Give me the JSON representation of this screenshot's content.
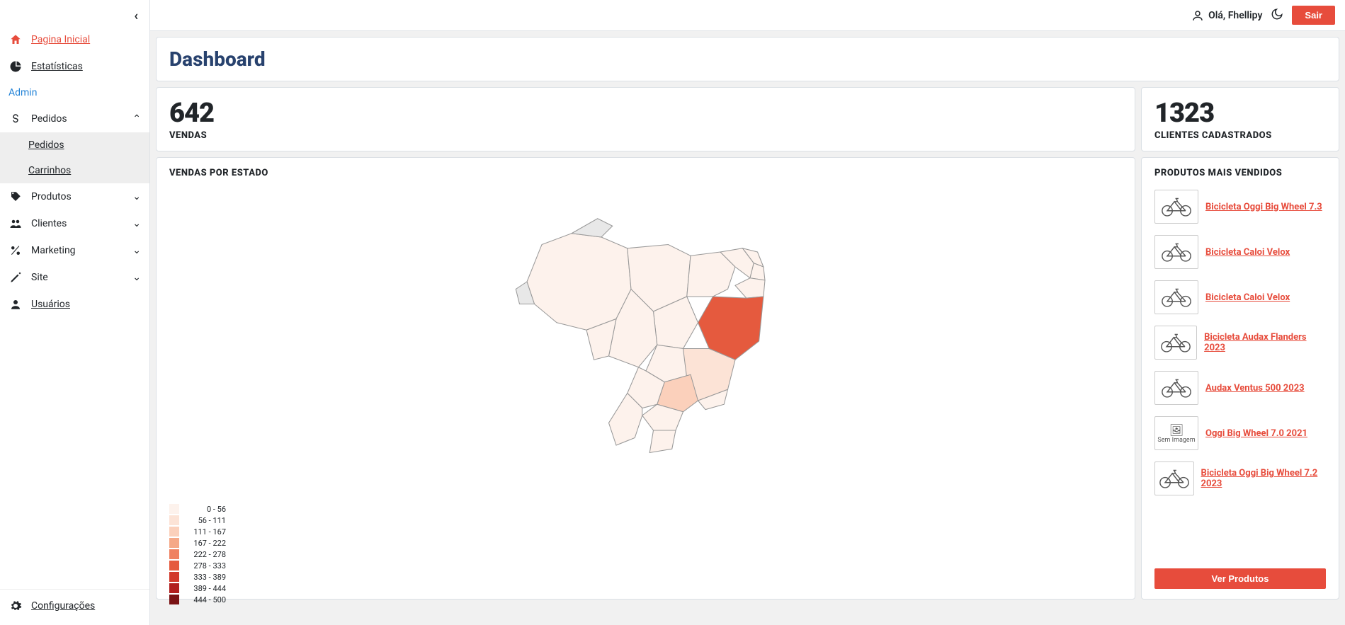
{
  "header": {
    "greeting": "Olá, Fhellipy",
    "logout": "Sair"
  },
  "page_title": "Dashboard",
  "sidebar": {
    "home": "Pagina Inicial",
    "stats": "Estatísticas",
    "section_admin": "Admin",
    "pedidos": "Pedidos",
    "pedidos_sub1": "Pedidos",
    "pedidos_sub2": "Carrinhos",
    "produtos": "Produtos",
    "clientes": "Clientes",
    "marketing": "Marketing",
    "site": "Site",
    "usuarios": "Usuários",
    "config": "Configurações"
  },
  "stats": {
    "sales_count": "642",
    "sales_label": "VENDAS",
    "clients_count": "1323",
    "clients_label": "CLIENTES CADASTRADOS"
  },
  "map": {
    "title": "VENDAS POR ESTADO",
    "legend": [
      {
        "range": "0 - 56",
        "color": "#fdf2ec"
      },
      {
        "range": "56 - 111",
        "color": "#fce3d6"
      },
      {
        "range": "111 - 167",
        "color": "#fbd0bb"
      },
      {
        "range": "167 - 222",
        "color": "#f5a887"
      },
      {
        "range": "222 - 278",
        "color": "#ef8161"
      },
      {
        "range": "278 - 333",
        "color": "#e55a3e"
      },
      {
        "range": "333 - 389",
        "color": "#d2382a"
      },
      {
        "range": "389 - 444",
        "color": "#b11e1d"
      },
      {
        "range": "444 - 500",
        "color": "#7a1314"
      }
    ]
  },
  "top_products": {
    "title": "PRODUTOS MAIS VENDIDOS",
    "items": [
      {
        "name": "Bicicleta Oggi Big Wheel 7.3",
        "has_image": true
      },
      {
        "name": "Bicicleta Caloi Velox",
        "has_image": true
      },
      {
        "name": "Bicicleta Caloi Velox",
        "has_image": true
      },
      {
        "name": "Bicicleta Audax Flanders 2023",
        "has_image": true
      },
      {
        "name": "Audax Ventus 500 2023",
        "has_image": true
      },
      {
        "name": "Oggi Big Wheel 7.0 2021",
        "has_image": false
      },
      {
        "name": "Bicicleta Oggi Big Wheel 7.2 2023",
        "has_image": true
      }
    ],
    "no_image_label": "Sem Imagem",
    "see_all": "Ver Produtos"
  },
  "chart_data": {
    "type": "heatmap",
    "title": "Vendas por Estado",
    "geography": "Brazil states",
    "value_range": [
      0,
      500
    ],
    "legend_bins": [
      {
        "min": 0,
        "max": 56
      },
      {
        "min": 56,
        "max": 111
      },
      {
        "min": 111,
        "max": 167
      },
      {
        "min": 167,
        "max": 222
      },
      {
        "min": 222,
        "max": 278
      },
      {
        "min": 278,
        "max": 333
      },
      {
        "min": 333,
        "max": 389
      },
      {
        "min": 389,
        "max": 444
      },
      {
        "min": 444,
        "max": 500
      }
    ],
    "highlighted_states_estimate": [
      {
        "state": "BA",
        "bin": "278 - 333"
      },
      {
        "state": "MG",
        "bin": "56 - 111"
      },
      {
        "state": "SP",
        "bin": "111 - 167"
      }
    ]
  }
}
